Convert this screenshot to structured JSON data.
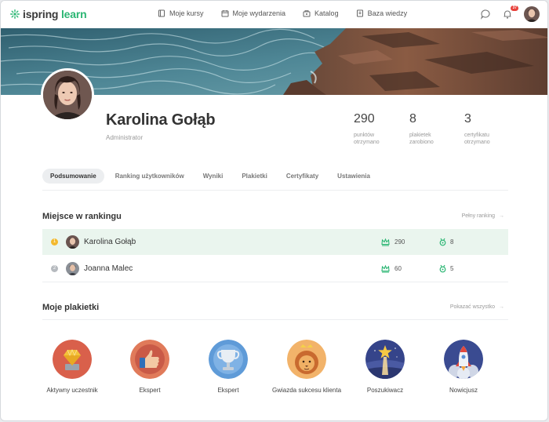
{
  "brand": {
    "logo_main": "ispring",
    "logo_accent": "learn"
  },
  "nav": {
    "items": [
      {
        "label": "Moje kursy",
        "icon": "book-icon"
      },
      {
        "label": "Moje wydarzenia",
        "icon": "calendar-icon"
      },
      {
        "label": "Katalog",
        "icon": "catalog-icon"
      },
      {
        "label": "Baza wiedzy",
        "icon": "knowledge-base-icon"
      }
    ],
    "notification_count": "37"
  },
  "profile": {
    "name": "Karolina Gołąb",
    "role": "Administrator",
    "stats": [
      {
        "value": "290",
        "label_line1": "punktów",
        "label_line2": "otrzymano"
      },
      {
        "value": "8",
        "label_line1": "plakietek",
        "label_line2": "zarobiono"
      },
      {
        "value": "3",
        "label_line1": "certyfikatu",
        "label_line2": "otrzymano"
      }
    ]
  },
  "tabs": [
    {
      "label": "Podsumowanie",
      "active": true
    },
    {
      "label": "Ranking użytkowników"
    },
    {
      "label": "Wyniki"
    },
    {
      "label": "Plakietki"
    },
    {
      "label": "Certyfikaty"
    },
    {
      "label": "Ustawienia"
    }
  ],
  "ranking": {
    "title": "Miejsce w rankingu",
    "link": "Pełny ranking",
    "rows": [
      {
        "place": "1",
        "name": "Karolina Gołąb",
        "points": "290",
        "badges": "8",
        "place_color": "#f3b92e"
      },
      {
        "place": "2",
        "name": "Joanna Malec",
        "points": "60",
        "badges": "5",
        "place_color": "#b6babf"
      }
    ]
  },
  "badges_section": {
    "title": "Moje plakietki",
    "link": "Pokazać wszystko",
    "items": [
      {
        "label": "Aktywny uczestnik",
        "icon": "diamond-icon"
      },
      {
        "label": "Ekspert",
        "icon": "thumbs-up-icon"
      },
      {
        "label": "Ekspert",
        "icon": "trophy-icon"
      },
      {
        "label": "Gwiazda sukcesu klienta",
        "icon": "lion-icon"
      },
      {
        "label": "Poszukiwacz",
        "icon": "star-icon"
      },
      {
        "label": "Nowicjusz",
        "icon": "rocket-icon"
      }
    ]
  },
  "colors": {
    "accent": "#2bb673",
    "highlight_row": "#eaf5ee",
    "badge_red": "#e8413b"
  }
}
